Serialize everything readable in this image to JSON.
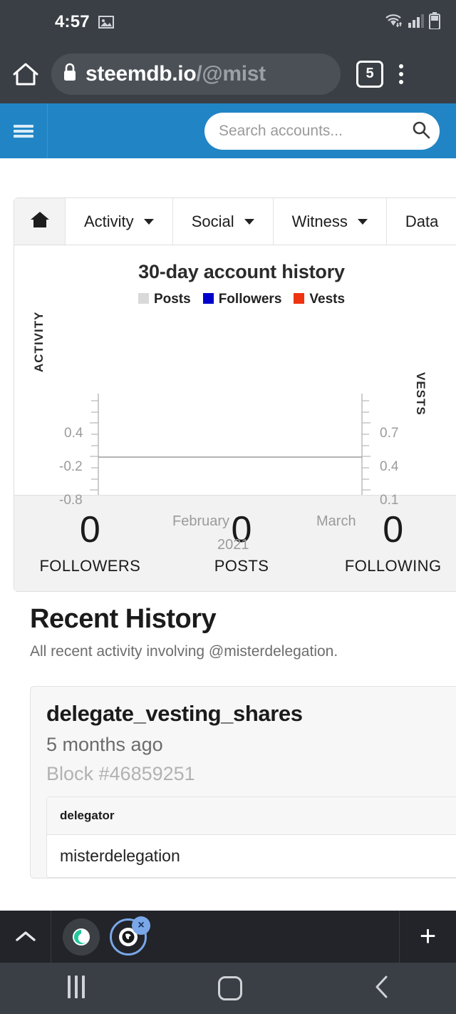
{
  "status_bar": {
    "clock": "4:57",
    "icons": [
      "photo-icon",
      "wifi-icon",
      "signal-icon",
      "battery-icon"
    ]
  },
  "browser": {
    "url_visible": "steemdb.io",
    "url_path": "/@mist",
    "tab_count": "5",
    "home_icon": "home-icon",
    "lock_icon": "lock-icon",
    "menu_icon": "overflow-menu-icon",
    "bottom_bar": {
      "collapse_icon": "chevron-up-icon",
      "new_tab_label": "+",
      "tabs": [
        {
          "name": "samsung-internet-tab",
          "active": false
        },
        {
          "name": "browser-tab",
          "active": true,
          "close_label": "×"
        }
      ]
    },
    "android_nav": [
      "recents-icon",
      "home-icon",
      "back-icon"
    ]
  },
  "site_nav": {
    "menu_icon": "hamburger-icon",
    "search_placeholder": "Search accounts...",
    "search_value": "",
    "search_icon": "search-icon",
    "brand_color": "#2185c5"
  },
  "tabs": [
    {
      "label": "",
      "icon": "home-icon",
      "active": true,
      "has_caret": false
    },
    {
      "label": "Activity",
      "active": false,
      "has_caret": true
    },
    {
      "label": "Social",
      "active": false,
      "has_caret": true
    },
    {
      "label": "Witness",
      "active": false,
      "has_caret": true
    },
    {
      "label": "Data",
      "active": false,
      "has_caret": false
    }
  ],
  "chart_data": {
    "type": "line",
    "title": "30-day account history",
    "xlabel": "",
    "ylabel": "ACTIVITY",
    "y2label": "VESTS",
    "grid": false,
    "legend_position": "top",
    "legend": [
      {
        "name": "Posts",
        "color": "#d9d9d9"
      },
      {
        "name": "Followers",
        "color": "#0000cc"
      },
      {
        "name": "Vests",
        "color": "#ee3311"
      }
    ],
    "x_tick_labels": [
      "February",
      "March"
    ],
    "x_period_label": "2021",
    "y_ticks": [
      "0.4",
      "-0.2",
      "-0.8"
    ],
    "y_tick_values": [
      0.4,
      -0.2,
      -0.8
    ],
    "y2_ticks": [
      "0.7",
      "0.4",
      "0.1"
    ],
    "y2_tick_values": [
      0.7,
      0.4,
      0.1
    ],
    "ylim": [
      -1.1,
      0.8
    ],
    "y2lim": [
      -0.05,
      0.95
    ],
    "series": [
      {
        "name": "Posts",
        "color": "#d9d9d9",
        "values": [
          0,
          0
        ]
      },
      {
        "name": "Followers",
        "color": "#0000cc",
        "values": [
          0,
          0
        ]
      },
      {
        "name": "Vests",
        "color": "#ee3311",
        "values": [
          0,
          0
        ]
      }
    ],
    "note": "All series flat at 0 across the 30-day window"
  },
  "stats": [
    {
      "value": "0",
      "label": "FOLLOWERS"
    },
    {
      "value": "0",
      "label": "POSTS"
    },
    {
      "value": "0",
      "label": "FOLLOWING"
    }
  ],
  "recent_history": {
    "title": "Recent History",
    "subtitle": "All recent activity involving @misterdelegation.",
    "entries": [
      {
        "operation": "delegate_vesting_shares",
        "time": "5 months ago",
        "block": "Block #46859251",
        "table": {
          "headers": [
            "delegator"
          ],
          "rows": [
            [
              "misterdelegation"
            ]
          ]
        }
      }
    ]
  }
}
